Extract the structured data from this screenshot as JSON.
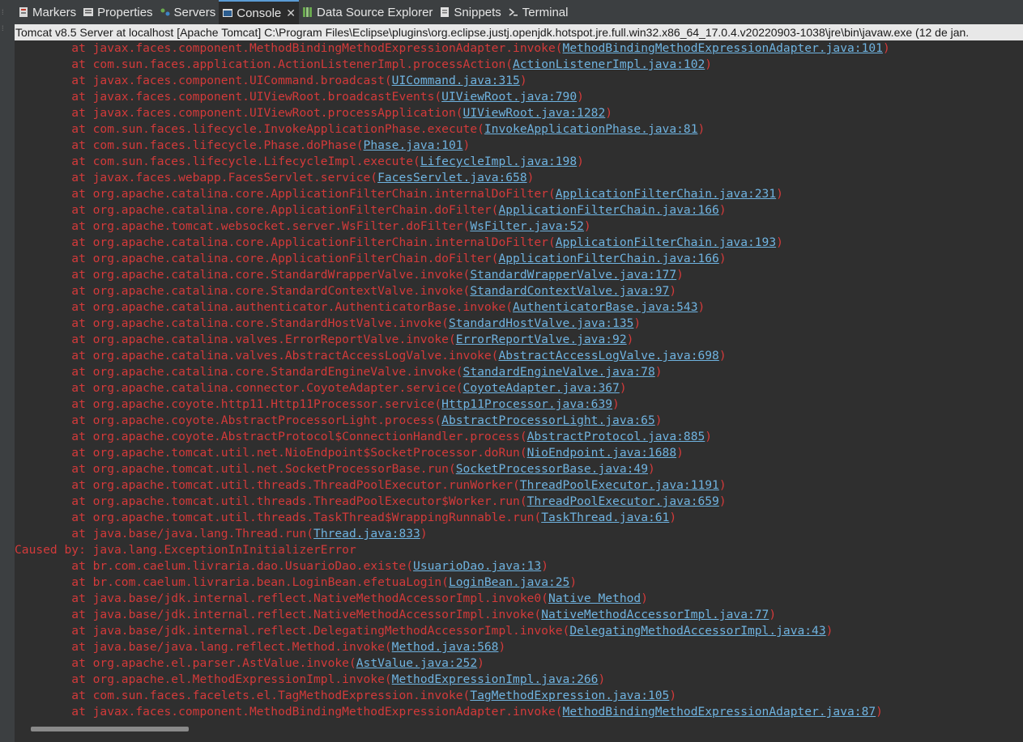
{
  "tabs": [
    {
      "label": "Markers",
      "icon": "markers-icon",
      "active": false
    },
    {
      "label": "Properties",
      "icon": "properties-icon",
      "active": false
    },
    {
      "label": "Servers",
      "icon": "servers-icon",
      "active": false
    },
    {
      "label": "Console",
      "icon": "console-icon",
      "active": true
    },
    {
      "label": "Data Source Explorer",
      "icon": "data-source-explorer-icon",
      "active": false
    },
    {
      "label": "Snippets",
      "icon": "snippets-icon",
      "active": false
    },
    {
      "label": "Terminal",
      "icon": "terminal-icon",
      "active": false
    }
  ],
  "console_title": "Tomcat v8.5 Server at localhost [Apache Tomcat] C:\\Program Files\\Eclipse\\plugins\\org.eclipse.justj.openjdk.hotspot.jre.full.win32.x86_64_17.0.4.v20220903-1038\\jre\\bin\\javaw.exe  (12 de jan.",
  "lines": [
    {
      "prefix": "        at javax.faces.component.MethodBindingMethodExpressionAdapter.invoke(",
      "link": "MethodBindingMethodExpressionAdapter.java:101",
      "suffix": ")"
    },
    {
      "prefix": "        at com.sun.faces.application.ActionListenerImpl.processAction(",
      "link": "ActionListenerImpl.java:102",
      "suffix": ")"
    },
    {
      "prefix": "        at javax.faces.component.UICommand.broadcast(",
      "link": "UICommand.java:315",
      "suffix": ")"
    },
    {
      "prefix": "        at javax.faces.component.UIViewRoot.broadcastEvents(",
      "link": "UIViewRoot.java:790",
      "suffix": ")"
    },
    {
      "prefix": "        at javax.faces.component.UIViewRoot.processApplication(",
      "link": "UIViewRoot.java:1282",
      "suffix": ")"
    },
    {
      "prefix": "        at com.sun.faces.lifecycle.InvokeApplicationPhase.execute(",
      "link": "InvokeApplicationPhase.java:81",
      "suffix": ")"
    },
    {
      "prefix": "        at com.sun.faces.lifecycle.Phase.doPhase(",
      "link": "Phase.java:101",
      "suffix": ")"
    },
    {
      "prefix": "        at com.sun.faces.lifecycle.LifecycleImpl.execute(",
      "link": "LifecycleImpl.java:198",
      "suffix": ")"
    },
    {
      "prefix": "        at javax.faces.webapp.FacesServlet.service(",
      "link": "FacesServlet.java:658",
      "suffix": ")"
    },
    {
      "prefix": "        at org.apache.catalina.core.ApplicationFilterChain.internalDoFilter(",
      "link": "ApplicationFilterChain.java:231",
      "suffix": ")"
    },
    {
      "prefix": "        at org.apache.catalina.core.ApplicationFilterChain.doFilter(",
      "link": "ApplicationFilterChain.java:166",
      "suffix": ")"
    },
    {
      "prefix": "        at org.apache.tomcat.websocket.server.WsFilter.doFilter(",
      "link": "WsFilter.java:52",
      "suffix": ")"
    },
    {
      "prefix": "        at org.apache.catalina.core.ApplicationFilterChain.internalDoFilter(",
      "link": "ApplicationFilterChain.java:193",
      "suffix": ")"
    },
    {
      "prefix": "        at org.apache.catalina.core.ApplicationFilterChain.doFilter(",
      "link": "ApplicationFilterChain.java:166",
      "suffix": ")"
    },
    {
      "prefix": "        at org.apache.catalina.core.StandardWrapperValve.invoke(",
      "link": "StandardWrapperValve.java:177",
      "suffix": ")"
    },
    {
      "prefix": "        at org.apache.catalina.core.StandardContextValve.invoke(",
      "link": "StandardContextValve.java:97",
      "suffix": ")"
    },
    {
      "prefix": "        at org.apache.catalina.authenticator.AuthenticatorBase.invoke(",
      "link": "AuthenticatorBase.java:543",
      "suffix": ")"
    },
    {
      "prefix": "        at org.apache.catalina.core.StandardHostValve.invoke(",
      "link": "StandardHostValve.java:135",
      "suffix": ")"
    },
    {
      "prefix": "        at org.apache.catalina.valves.ErrorReportValve.invoke(",
      "link": "ErrorReportValve.java:92",
      "suffix": ")"
    },
    {
      "prefix": "        at org.apache.catalina.valves.AbstractAccessLogValve.invoke(",
      "link": "AbstractAccessLogValve.java:698",
      "suffix": ")"
    },
    {
      "prefix": "        at org.apache.catalina.core.StandardEngineValve.invoke(",
      "link": "StandardEngineValve.java:78",
      "suffix": ")"
    },
    {
      "prefix": "        at org.apache.catalina.connector.CoyoteAdapter.service(",
      "link": "CoyoteAdapter.java:367",
      "suffix": ")"
    },
    {
      "prefix": "        at org.apache.coyote.http11.Http11Processor.service(",
      "link": "Http11Processor.java:639",
      "suffix": ")"
    },
    {
      "prefix": "        at org.apache.coyote.AbstractProcessorLight.process(",
      "link": "AbstractProcessorLight.java:65",
      "suffix": ")"
    },
    {
      "prefix": "        at org.apache.coyote.AbstractProtocol$ConnectionHandler.process(",
      "link": "AbstractProtocol.java:885",
      "suffix": ")"
    },
    {
      "prefix": "        at org.apache.tomcat.util.net.NioEndpoint$SocketProcessor.doRun(",
      "link": "NioEndpoint.java:1688",
      "suffix": ")"
    },
    {
      "prefix": "        at org.apache.tomcat.util.net.SocketProcessorBase.run(",
      "link": "SocketProcessorBase.java:49",
      "suffix": ")"
    },
    {
      "prefix": "        at org.apache.tomcat.util.threads.ThreadPoolExecutor.runWorker(",
      "link": "ThreadPoolExecutor.java:1191",
      "suffix": ")"
    },
    {
      "prefix": "        at org.apache.tomcat.util.threads.ThreadPoolExecutor$Worker.run(",
      "link": "ThreadPoolExecutor.java:659",
      "suffix": ")"
    },
    {
      "prefix": "        at org.apache.tomcat.util.threads.TaskThread$WrappingRunnable.run(",
      "link": "TaskThread.java:61",
      "suffix": ")"
    },
    {
      "prefix": "        at java.base/java.lang.Thread.run(",
      "link": "Thread.java:833",
      "suffix": ")"
    },
    {
      "prefix": "Caused by: java.lang.ExceptionInInitializerError",
      "link": "",
      "suffix": ""
    },
    {
      "prefix": "        at br.com.caelum.livraria.dao.UsuarioDao.existe(",
      "link": "UsuarioDao.java:13",
      "suffix": ")"
    },
    {
      "prefix": "        at br.com.caelum.livraria.bean.LoginBean.efetuaLogin(",
      "link": "LoginBean.java:25",
      "suffix": ")"
    },
    {
      "prefix": "        at java.base/jdk.internal.reflect.NativeMethodAccessorImpl.invoke0(",
      "link": "Native Method",
      "suffix": ")"
    },
    {
      "prefix": "        at java.base/jdk.internal.reflect.NativeMethodAccessorImpl.invoke(",
      "link": "NativeMethodAccessorImpl.java:77",
      "suffix": ")"
    },
    {
      "prefix": "        at java.base/jdk.internal.reflect.DelegatingMethodAccessorImpl.invoke(",
      "link": "DelegatingMethodAccessorImpl.java:43",
      "suffix": ")"
    },
    {
      "prefix": "        at java.base/java.lang.reflect.Method.invoke(",
      "link": "Method.java:568",
      "suffix": ")"
    },
    {
      "prefix": "        at org.apache.el.parser.AstValue.invoke(",
      "link": "AstValue.java:252",
      "suffix": ")"
    },
    {
      "prefix": "        at org.apache.el.MethodExpressionImpl.invoke(",
      "link": "MethodExpressionImpl.java:266",
      "suffix": ")"
    },
    {
      "prefix": "        at com.sun.faces.facelets.el.TagMethodExpression.invoke(",
      "link": "TagMethodExpression.java:105",
      "suffix": ")"
    },
    {
      "prefix": "        at javax.faces.component.MethodBindingMethodExpressionAdapter.invoke(",
      "link": "MethodBindingMethodExpressionAdapter.java:87",
      "suffix": ")"
    }
  ]
}
